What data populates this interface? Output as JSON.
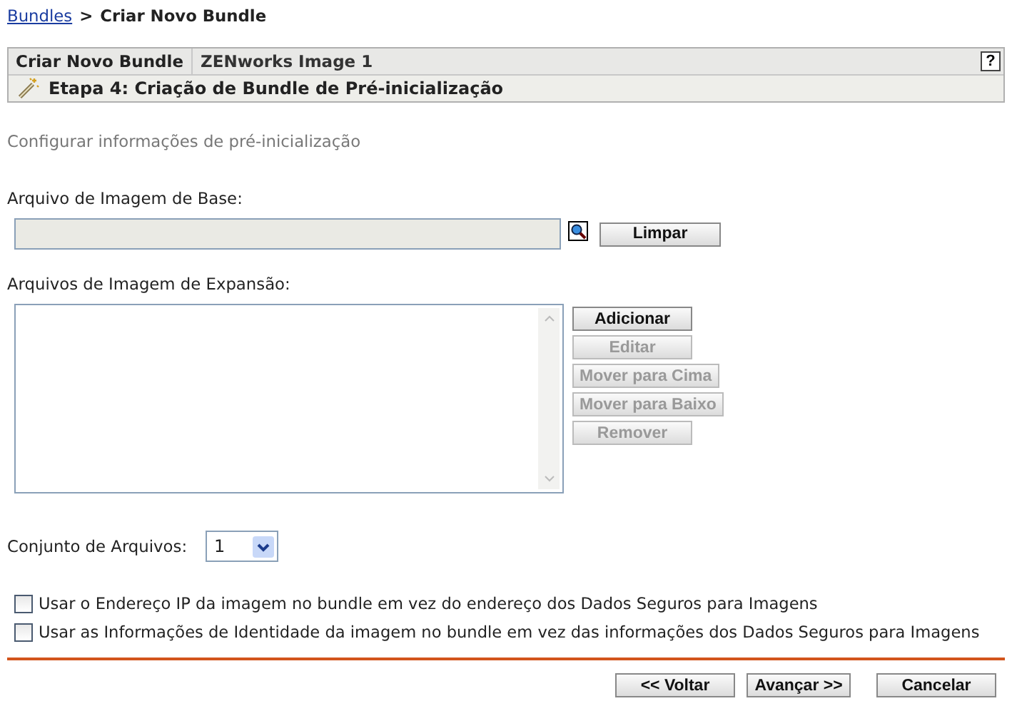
{
  "breadcrumb": {
    "link": "Bundles",
    "separator": ">",
    "current": "Criar Novo Bundle"
  },
  "header": {
    "title": "Criar Novo Bundle",
    "name": "ZENworks Image 1",
    "help": "?",
    "step": "Etapa 4: Criação de Bundle de Pré-inicialização"
  },
  "subtitle": "Configurar informações de pré-inicialização",
  "base_image": {
    "label": "Arquivo de Imagem de Base:",
    "clear_button": "Limpar"
  },
  "expansion_images": {
    "label": "Arquivos de Imagem de Expansão:",
    "buttons": [
      {
        "label": "Adicionar",
        "disabled": false
      },
      {
        "label": "Editar",
        "disabled": true
      },
      {
        "label": "Mover para Cima",
        "disabled": true
      },
      {
        "label": "Mover para Baixo",
        "disabled": true
      },
      {
        "label": "Remover",
        "disabled": true
      }
    ]
  },
  "file_set": {
    "label": "Conjunto de Arquivos:",
    "value": "1"
  },
  "options": [
    {
      "label": "Usar o Endereço IP da imagem no bundle em vez do endereço dos Dados Seguros para Imagens",
      "checked": false
    },
    {
      "label": "Usar as Informações de Identidade da imagem no bundle em vez das informações dos Dados Seguros para Imagens",
      "checked": false
    }
  ],
  "footer_buttons": [
    "<< Voltar",
    "Avançar >>",
    "Cancelar"
  ]
}
